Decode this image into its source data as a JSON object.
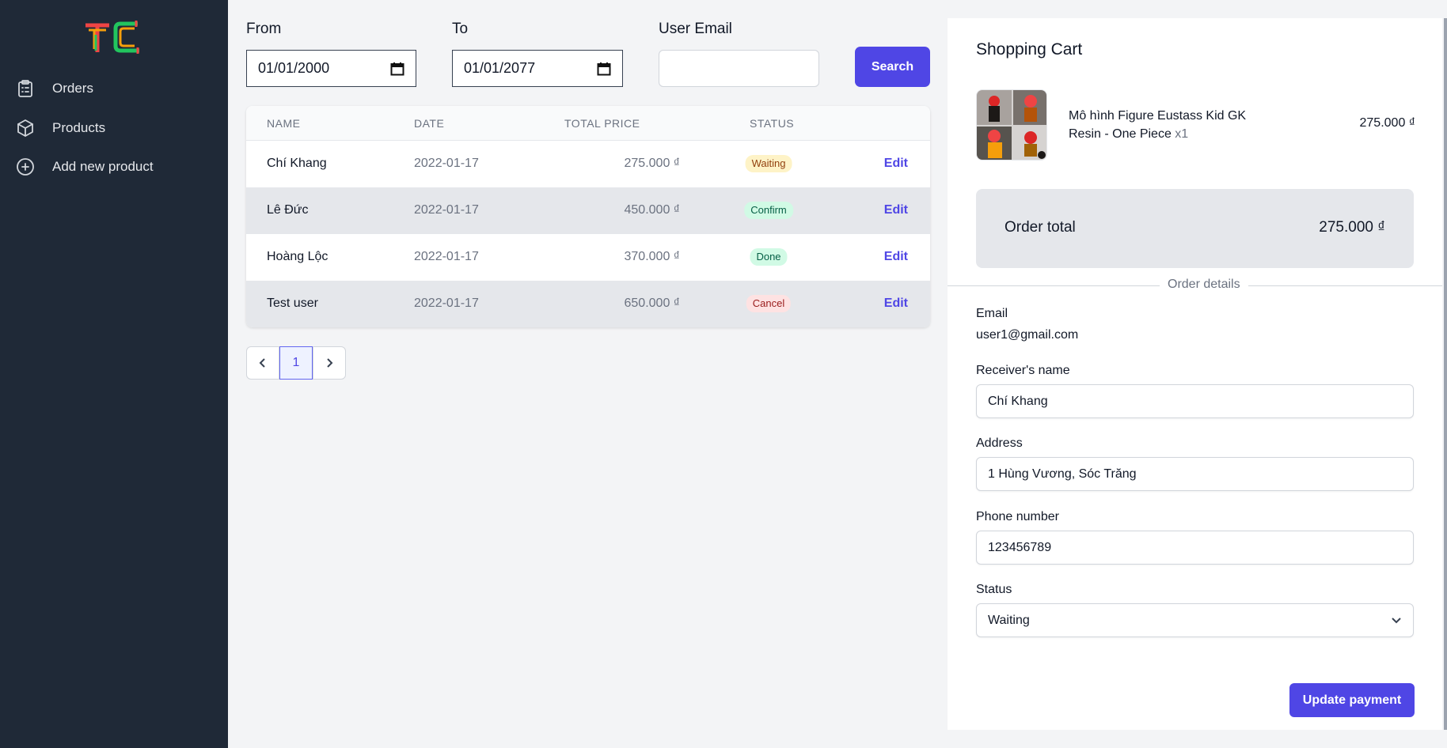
{
  "sidebar": {
    "logo_text": "TC",
    "items": [
      {
        "label": "Orders",
        "icon": "clipboard-icon"
      },
      {
        "label": "Products",
        "icon": "cube-icon"
      },
      {
        "label": "Add new product",
        "icon": "plus-circle-icon"
      }
    ]
  },
  "filters": {
    "from_label": "From",
    "from_value": "01/01/2000",
    "to_label": "To",
    "to_value": "01/01/2077",
    "email_label": "User Email",
    "email_value": "",
    "search_label": "Search"
  },
  "table": {
    "headers": [
      "NAME",
      "DATE",
      "TOTAL PRICE",
      "STATUS"
    ],
    "rows": [
      {
        "name": "Chí Khang",
        "date": "2022-01-17",
        "price": "275.000 ₫",
        "status": "Waiting",
        "action": "Edit"
      },
      {
        "name": "Lê Đức",
        "date": "2022-01-17",
        "price": "450.000 ₫",
        "status": "Confirm",
        "action": "Edit"
      },
      {
        "name": "Hoàng Lộc",
        "date": "2022-01-17",
        "price": "370.000 ₫",
        "status": "Done",
        "action": "Edit"
      },
      {
        "name": "Test user",
        "date": "2022-01-17",
        "price": "650.000 ₫",
        "status": "Cancel",
        "action": "Edit"
      }
    ]
  },
  "pagination": {
    "current": "1"
  },
  "cart": {
    "title": "Shopping Cart",
    "item": {
      "name": "Mô hình Figure Eustass Kid GK Resin - One Piece",
      "qty": "x1",
      "price": "275.000 ₫"
    },
    "total_label": "Order total",
    "total_value": "275.000 ₫",
    "details_label": "Order details",
    "email_label": "Email",
    "email_value": "user1@gmail.com",
    "receiver_label": "Receiver's name",
    "receiver_value": "Chí Khang",
    "address_label": "Address",
    "address_value": "1 Hùng Vương, Sóc Trăng",
    "phone_label": "Phone number",
    "phone_value": "123456789",
    "status_label": "Status",
    "status_value": "Waiting",
    "update_label": "Update payment"
  },
  "colors": {
    "accent": "#4f46e5",
    "sidebar_bg": "#1f2937",
    "waiting": "#fef3c7",
    "confirm": "#d1fae5",
    "done": "#d1fae5",
    "cancel": "#fee2e2"
  }
}
